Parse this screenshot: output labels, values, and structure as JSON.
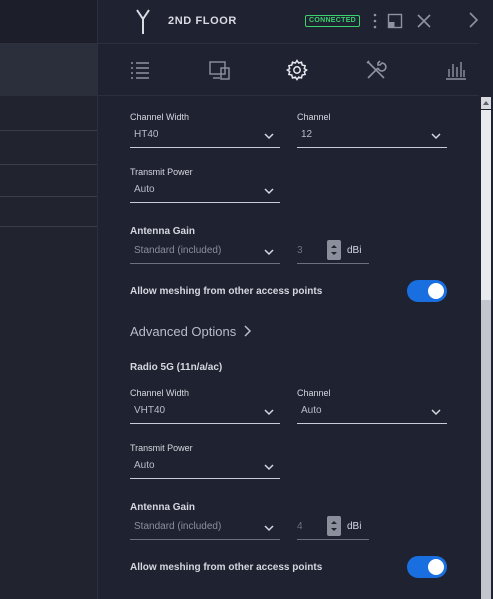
{
  "header": {
    "title": "2ND FLOOR",
    "status": "CONNECTED",
    "icons": [
      "device-icon",
      "more-icon",
      "window-icon",
      "close-icon",
      "expand-icon"
    ]
  },
  "tabs": [
    {
      "name": "list-icon"
    },
    {
      "name": "devices-icon"
    },
    {
      "name": "settings-icon"
    },
    {
      "name": "tools-icon"
    },
    {
      "name": "stats-icon"
    }
  ],
  "radio24": {
    "channel_width_label": "Channel Width",
    "channel_width": "HT40",
    "channel_label": "Channel",
    "channel": "12",
    "tx_power_label": "Transmit Power",
    "tx_power": "Auto",
    "antenna_gain_label": "Antenna Gain",
    "antenna_gain": "Standard (included)",
    "gain_value": "3",
    "gain_unit": "dBi",
    "meshing_label": "Allow meshing from other access points",
    "meshing_on": true
  },
  "advanced_label": "Advanced Options",
  "radio5": {
    "title": "Radio 5G (11n/a/ac)",
    "channel_width_label": "Channel Width",
    "channel_width": "VHT40",
    "channel_label": "Channel",
    "channel": "Auto",
    "tx_power_label": "Transmit Power",
    "tx_power": "Auto",
    "antenna_gain_label": "Antenna Gain",
    "antenna_gain": "Standard (included)",
    "gain_value": "4",
    "gain_unit": "dBi",
    "meshing_label": "Allow meshing from other access points",
    "meshing_on": true
  },
  "colors": {
    "accent": "#1a6fe0",
    "connected": "#3bd16f",
    "panel_bg": "#1f2230"
  }
}
